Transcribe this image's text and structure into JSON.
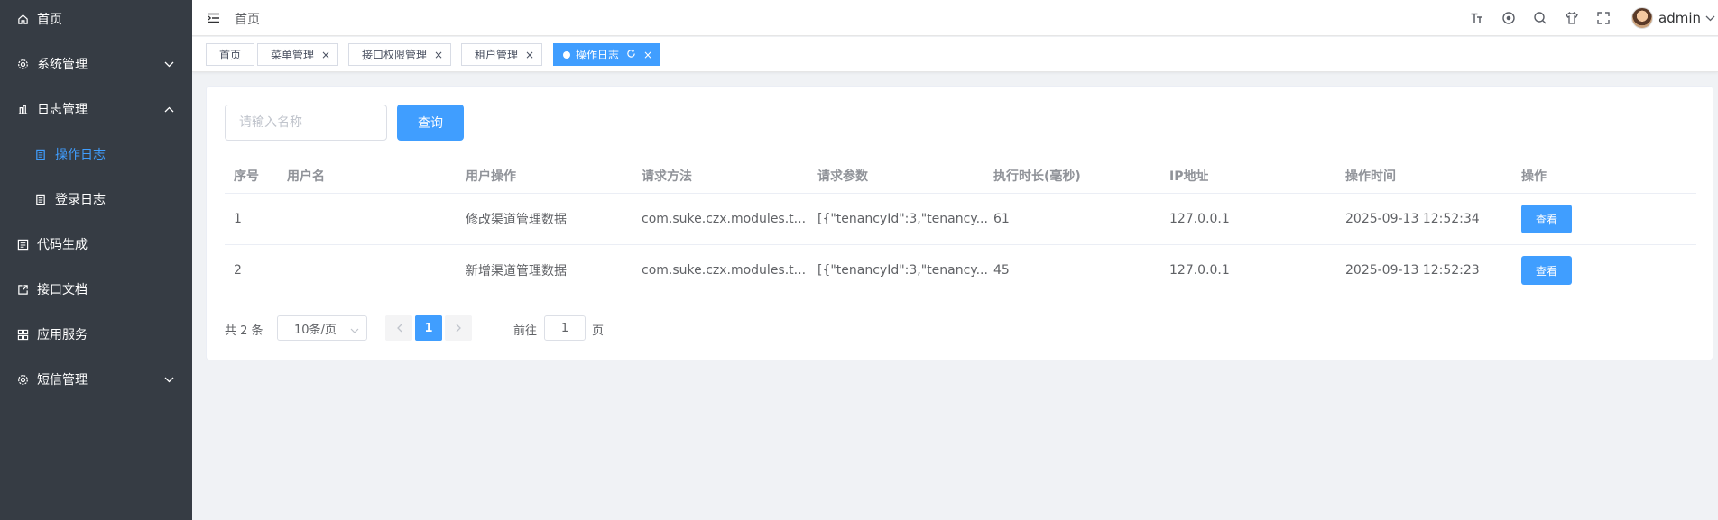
{
  "sidebar": {
    "items": [
      {
        "label": "首页",
        "icon": "home-icon"
      },
      {
        "label": "系统管理",
        "icon": "gear-icon"
      },
      {
        "label": "日志管理",
        "icon": "chart-icon"
      },
      {
        "label": "操作日志",
        "icon": "document-icon"
      },
      {
        "label": "登录日志",
        "icon": "document-icon"
      },
      {
        "label": "代码生成",
        "icon": "code-icon"
      },
      {
        "label": "接口文档",
        "icon": "external-doc-icon"
      },
      {
        "label": "应用服务",
        "icon": "apps-icon"
      },
      {
        "label": "短信管理",
        "icon": "gear-icon"
      }
    ]
  },
  "header": {
    "breadcrumb": "首页",
    "user_name": "admin"
  },
  "tags": [
    {
      "label": "首页"
    },
    {
      "label": "菜单管理",
      "close": "×"
    },
    {
      "label": "接口权限管理",
      "close": "×"
    },
    {
      "label": "租户管理",
      "close": "×"
    },
    {
      "label": "操作日志",
      "close": "×",
      "active": true
    }
  ],
  "search": {
    "placeholder": "请输入名称",
    "button_label": "查询"
  },
  "table": {
    "columns": [
      "序号",
      "用户名",
      "用户操作",
      "请求方法",
      "请求参数",
      "执行时长(毫秒)",
      "IP地址",
      "操作时间",
      "操作"
    ],
    "rows": [
      {
        "index": "1",
        "username": "",
        "operation": "修改渠道管理数据",
        "method": "com.suke.czx.modules.t...",
        "params": "[{\"tenancyId\":3,\"tenancy...",
        "duration": "61",
        "ip": "127.0.0.1",
        "time": "2025-09-13 12:52:34",
        "action": "查看"
      },
      {
        "index": "2",
        "username": "",
        "operation": "新增渠道管理数据",
        "method": "com.suke.czx.modules.t...",
        "params": "[{\"tenancyId\":3,\"tenancy...",
        "duration": "45",
        "ip": "127.0.0.1",
        "time": "2025-09-13 12:52:23",
        "action": "查看"
      }
    ]
  },
  "pagination": {
    "total_text": "共 2 条",
    "page_size": "10条/页",
    "current_page": "1",
    "goto_label": "前往",
    "goto_value": "1",
    "page_label": "页"
  },
  "colors": {
    "sidebar_bg": "#363c44",
    "accent": "#409eff"
  }
}
